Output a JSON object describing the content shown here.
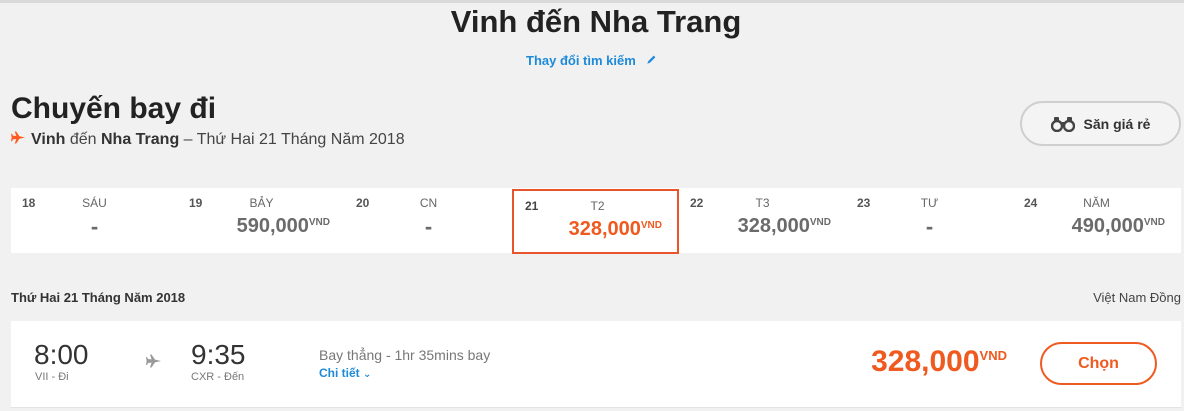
{
  "header": {
    "route_title": "Vinh đến Nha Trang",
    "change_search_label": "Thay đổi tìm kiếm"
  },
  "outbound": {
    "title": "Chuyến bay đi",
    "origin": "Vinh",
    "connector": "đến",
    "destination": "Nha Trang",
    "date_suffix": "– Thứ Hai 21 Tháng Năm 2018"
  },
  "deal_button": {
    "label": "Săn giá rẻ",
    "icon": "binoculars-icon"
  },
  "date_strip": [
    {
      "day": "18",
      "weekday": "SÁU",
      "price": "-",
      "currency": ""
    },
    {
      "day": "19",
      "weekday": "BẢY",
      "price": "590,000",
      "currency": "VND"
    },
    {
      "day": "20",
      "weekday": "CN",
      "price": "-",
      "currency": ""
    },
    {
      "day": "21",
      "weekday": "T2",
      "price": "328,000",
      "currency": "VND",
      "selected": true
    },
    {
      "day": "22",
      "weekday": "T3",
      "price": "328,000",
      "currency": "VND"
    },
    {
      "day": "23",
      "weekday": "TƯ",
      "price": "-",
      "currency": ""
    },
    {
      "day": "24",
      "weekday": "NĂM",
      "price": "490,000",
      "currency": "VND"
    }
  ],
  "results": {
    "date_heading": "Thứ Hai 21 Tháng Năm 2018",
    "currency_label": "Việt Nam Đồng"
  },
  "flight": {
    "depart_time": "8:00",
    "depart_airport": "VII - Đi",
    "arrive_time": "9:35",
    "arrive_airport": "CXR - Đến",
    "info": "Bay thẳng - 1hr 35mins bay",
    "details_label": "Chi tiết",
    "price": "328,000",
    "currency": "VND",
    "select_label": "Chọn"
  },
  "colors": {
    "accent": "#ee5a1f",
    "link": "#1d8ad9"
  }
}
